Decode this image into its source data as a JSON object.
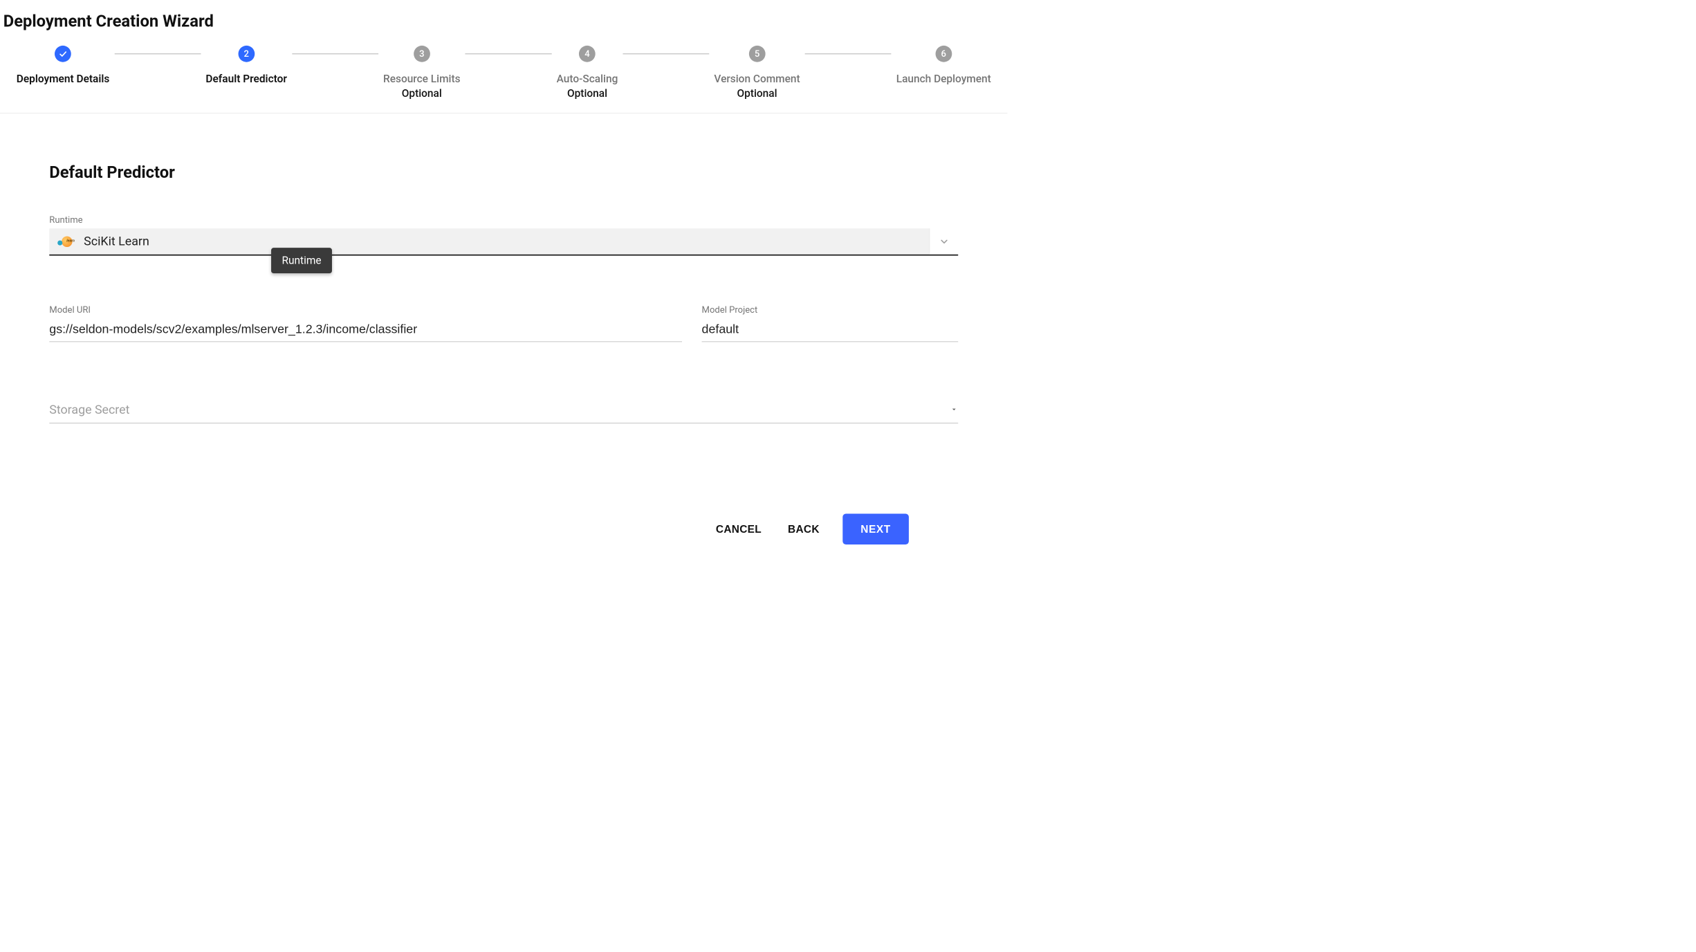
{
  "page_title": "Deployment Creation Wizard",
  "stepper": {
    "steps": [
      {
        "num": "1",
        "label": "Deployment Details",
        "state": "done"
      },
      {
        "num": "2",
        "label": "Default Predictor",
        "state": "active"
      },
      {
        "num": "3",
        "label": "Resource Limits",
        "optional": "Optional",
        "state": "pending"
      },
      {
        "num": "4",
        "label": "Auto-Scaling",
        "optional": "Optional",
        "state": "pending"
      },
      {
        "num": "5",
        "label": "Version Comment",
        "optional": "Optional",
        "state": "pending"
      },
      {
        "num": "6",
        "label": "Launch Deployment",
        "state": "pending"
      }
    ]
  },
  "section_title": "Default Predictor",
  "runtime": {
    "label": "Runtime",
    "value": "SciKit Learn",
    "icon": "scikit-learn-icon",
    "tooltip": "Runtime"
  },
  "model_uri": {
    "label": "Model URI",
    "value": "gs://seldon-models/scv2/examples/mlserver_1.2.3/income/classifier"
  },
  "model_project": {
    "label": "Model Project",
    "value": "default"
  },
  "storage_secret": {
    "placeholder": "Storage Secret",
    "value": ""
  },
  "buttons": {
    "cancel": "CANCEL",
    "back": "BACK",
    "next": "NEXT"
  }
}
